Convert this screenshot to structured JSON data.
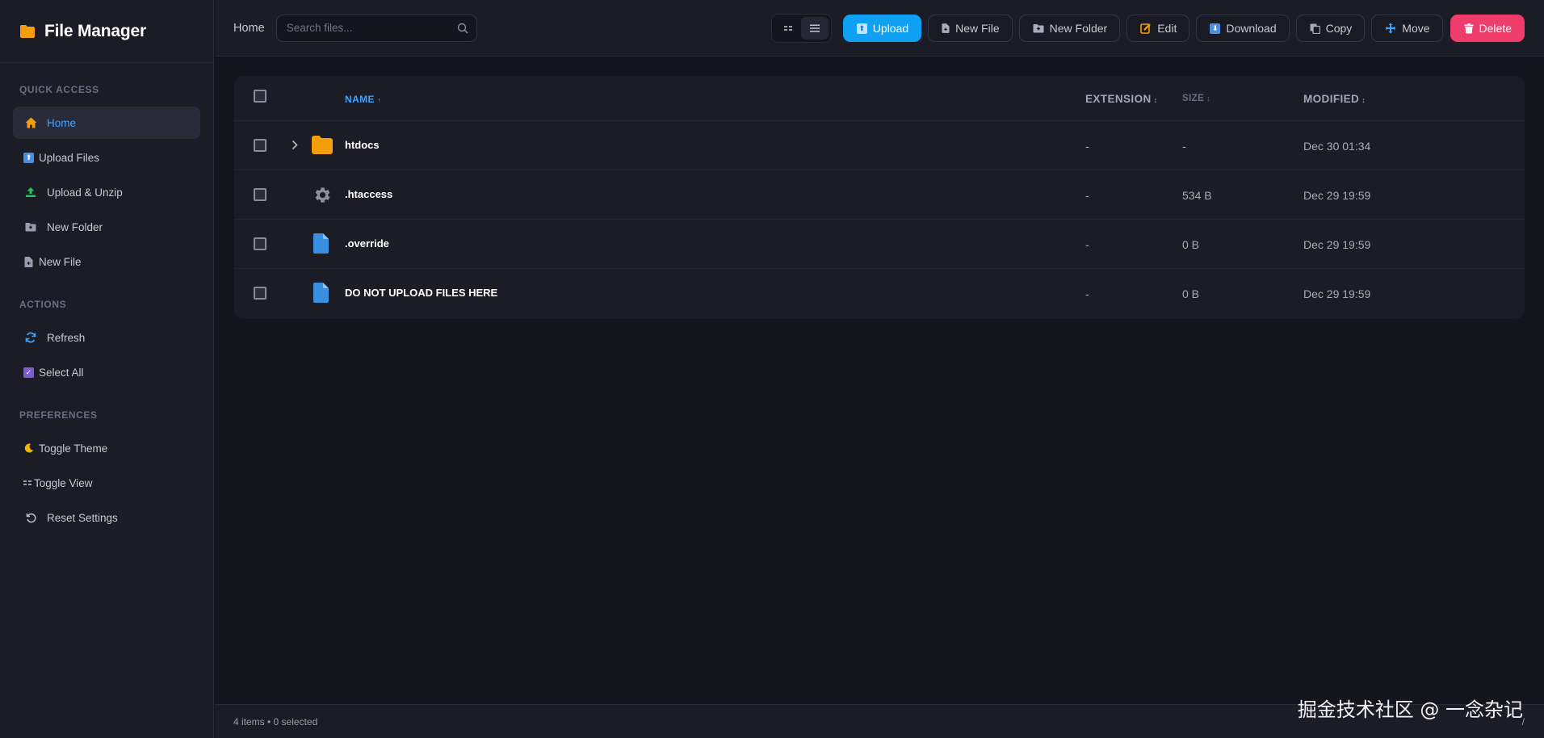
{
  "app": {
    "title": "File Manager"
  },
  "sidebar": {
    "sections": [
      {
        "title": "QUICK ACCESS",
        "items": [
          {
            "label": "Home",
            "icon": "home-icon",
            "active": true
          },
          {
            "label": "Upload Files",
            "icon": "upload-box-icon"
          },
          {
            "label": "Upload & Unzip",
            "icon": "upload-unzip-icon"
          },
          {
            "label": "New Folder",
            "icon": "folder-plus-icon"
          },
          {
            "label": "New File",
            "icon": "file-plus-icon"
          }
        ]
      },
      {
        "title": "ACTIONS",
        "items": [
          {
            "label": "Refresh",
            "icon": "refresh-icon"
          },
          {
            "label": "Select All",
            "icon": "checkbox-checked-icon"
          }
        ]
      },
      {
        "title": "PREFERENCES",
        "items": [
          {
            "label": "Toggle Theme",
            "icon": "moon-icon"
          },
          {
            "label": "Toggle View",
            "icon": "grid-icon"
          },
          {
            "label": "Reset Settings",
            "icon": "reset-icon"
          }
        ]
      }
    ]
  },
  "topbar": {
    "breadcrumb": "Home",
    "search": {
      "placeholder": "Search files...",
      "value": ""
    },
    "buttons": {
      "upload": "Upload",
      "new_file": "New File",
      "new_folder": "New Folder",
      "edit": "Edit",
      "download": "Download",
      "copy": "Copy",
      "move": "Move",
      "delete": "Delete"
    }
  },
  "table": {
    "columns": {
      "name": "NAME",
      "extension": "EXTENSION",
      "size": "SIZE",
      "modified": "MODIFIED"
    },
    "sort_indicator": "↑",
    "sortable_indicator": "↕",
    "rows": [
      {
        "name": "htdocs",
        "extension": "-",
        "size": "-",
        "modified": "Dec 30 01:34",
        "type": "folder"
      },
      {
        "name": ".htaccess",
        "extension": "-",
        "size": "534 B",
        "modified": "Dec 29 19:59",
        "type": "config"
      },
      {
        "name": ".override",
        "extension": "-",
        "size": "0 B",
        "modified": "Dec 29 19:59",
        "type": "file"
      },
      {
        "name": "DO NOT UPLOAD FILES HERE",
        "extension": "-",
        "size": "0 B",
        "modified": "Dec 29 19:59",
        "type": "file"
      }
    ]
  },
  "status": {
    "count": "4 items • 0 selected",
    "path": "/"
  },
  "watermark": "掘金技术社区 @ 一念杂记",
  "colors": {
    "accent": "#0ea0f3",
    "danger": "#ef3d6b",
    "folder": "#f59e0b",
    "file": "#3b8fe0",
    "background": "#14141c",
    "panel": "#1c1c27"
  }
}
